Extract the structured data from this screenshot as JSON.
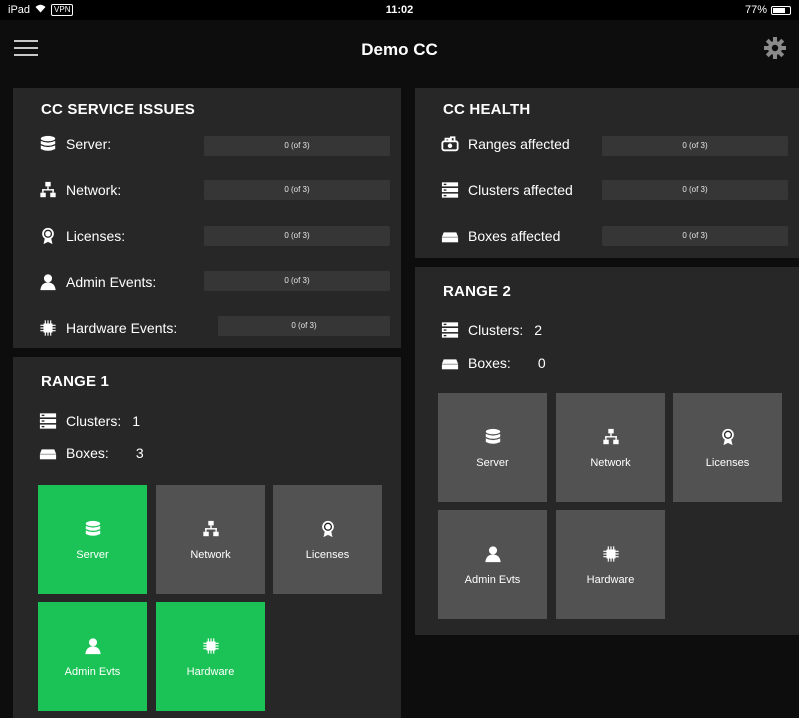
{
  "status_bar": {
    "device": "iPad",
    "vpn": "VPN",
    "time": "11:02",
    "battery": "77%",
    "battery_level": 0.77
  },
  "nav": {
    "title": "Demo CC"
  },
  "service_issues": {
    "title": "CC SERVICE ISSUES",
    "items": [
      {
        "label": "Server:",
        "value": "0 (of 3)",
        "icon": "server-icon"
      },
      {
        "label": "Network:",
        "value": "0 (of 3)",
        "icon": "network-icon"
      },
      {
        "label": "Licenses:",
        "value": "0 (of 3)",
        "icon": "license-icon"
      },
      {
        "label": "Admin Events:",
        "value": "0 (of 3)",
        "icon": "user-icon"
      },
      {
        "label": "Hardware Events:",
        "value": "0 (of 3)",
        "icon": "chip-icon"
      }
    ]
  },
  "health": {
    "title": "CC HEALTH",
    "items": [
      {
        "label": "Ranges affected",
        "value": "0 (of 3)",
        "icon": "ranges-icon"
      },
      {
        "label": "Clusters affected",
        "value": "0 (of 3)",
        "icon": "clusters-icon"
      },
      {
        "label": "Boxes affected",
        "value": "0 (of 3)",
        "icon": "box-icon"
      }
    ]
  },
  "range1": {
    "title": "RANGE 1",
    "clusters_label": "Clusters:",
    "clusters_value": "1",
    "boxes_label": "Boxes:",
    "boxes_value": "3",
    "tiles": [
      {
        "label": "Server",
        "icon": "server-icon",
        "status": "ok",
        "color": "#1bc356"
      },
      {
        "label": "Network",
        "icon": "network-icon",
        "status": "neutral",
        "color": "#525252"
      },
      {
        "label": "Licenses",
        "icon": "license-icon",
        "status": "neutral",
        "color": "#525252"
      },
      {
        "label": "Admin Evts",
        "icon": "user-icon",
        "status": "ok",
        "color": "#1bc356"
      },
      {
        "label": "Hardware",
        "icon": "chip-icon",
        "status": "ok",
        "color": "#1bc356"
      }
    ]
  },
  "range2": {
    "title": "RANGE 2",
    "clusters_label": "Clusters:",
    "clusters_value": "2",
    "boxes_label": "Boxes:",
    "boxes_value": "0",
    "tiles": [
      {
        "label": "Server",
        "icon": "server-icon",
        "status": "neutral",
        "color": "#525252"
      },
      {
        "label": "Network",
        "icon": "network-icon",
        "status": "neutral",
        "color": "#525252"
      },
      {
        "label": "Licenses",
        "icon": "license-icon",
        "status": "neutral",
        "color": "#525252"
      },
      {
        "label": "Admin Evts",
        "icon": "user-icon",
        "status": "neutral",
        "color": "#525252"
      },
      {
        "label": "Hardware",
        "icon": "chip-icon",
        "status": "neutral",
        "color": "#525252"
      }
    ]
  },
  "colors": {
    "background": "#0d0d0d",
    "panel": "#272727",
    "bar": "#363636",
    "tile": "#525252",
    "ok": "#1bc356"
  }
}
